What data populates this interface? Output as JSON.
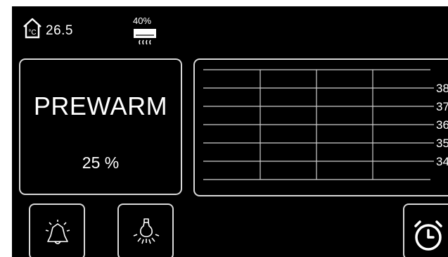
{
  "status": {
    "room_temperature": "26.5",
    "ac_level": "40%",
    "temperature_icon": "house-thermometer-icon",
    "ac_icon": "air-conditioner-icon"
  },
  "mode": {
    "name": "PREWARM",
    "progress": "25 %"
  },
  "graph": {
    "y_ticks": [
      "38",
      "37",
      "36",
      "35",
      "34"
    ],
    "line_color": "#ffffff"
  },
  "buttons": {
    "alarm_icon": "alarm-bell-icon",
    "light_icon": "light-bulb-icon",
    "timer_icon": "timer-icon"
  }
}
